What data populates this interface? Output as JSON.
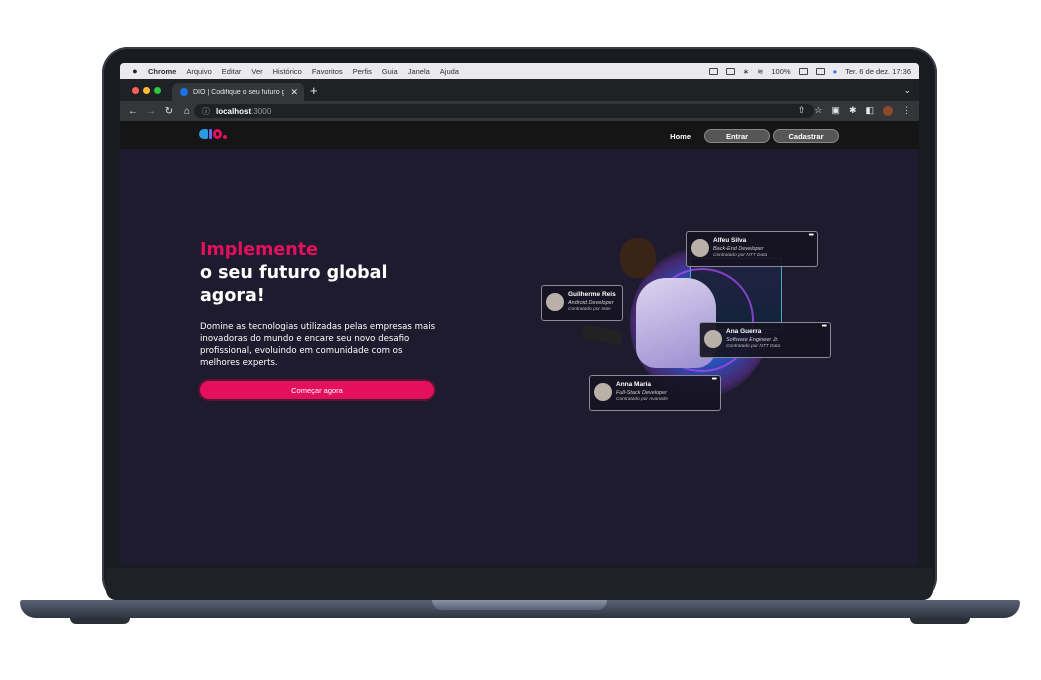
{
  "menubar": {
    "app_name": "Chrome",
    "menus": [
      "Arquivo",
      "Editar",
      "Ver",
      "Histórico",
      "Favoritos",
      "Perfis",
      "Guia",
      "Janela",
      "Ajuda"
    ],
    "battery": "100%",
    "datetime": "Ter. 6 de dez.  17:36"
  },
  "browser": {
    "tab_title": "DIO | Codifique o seu futuro gl",
    "url_host": "localhost",
    "url_port": ":3000"
  },
  "site": {
    "nav": {
      "home": "Home",
      "login": "Entrar",
      "signup": "Cadastrar"
    },
    "hero": {
      "title_accent": "Implemente",
      "title_line2": "o seu futuro global",
      "title_line3": "agora!",
      "description": "Domine as tecnologias utilizadas pelas empresas mais inovadoras do mundo e encare seu novo desafio profissional, evoluindo em comunidade com os melhores experts.",
      "cta": "Começar agora"
    },
    "cards": [
      {
        "name": "Alfeu Silva",
        "role": "Back-End Developer",
        "hired": "Contratado por NTT Data"
      },
      {
        "name": "Guilherme Reis",
        "role": "Android Developer",
        "hired": "Contratado por Inter"
      },
      {
        "name": "Ana Guerra",
        "role": "Software Engineer Jr.",
        "hired": "Contratado por NTT Data"
      },
      {
        "name": "Anna Maria",
        "role": "Full-Stack Developer",
        "hired": "Contratado por Avanade"
      }
    ]
  },
  "colors": {
    "accent": "#e4105d",
    "page_bg": "#1f1b2e",
    "header_bg": "#151515"
  }
}
